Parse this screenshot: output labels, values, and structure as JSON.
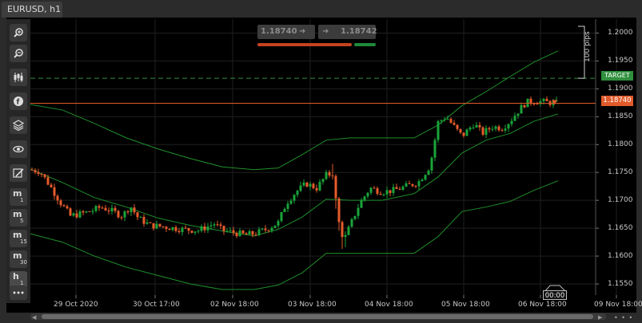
{
  "tab": {
    "title": "EURUSD, h1"
  },
  "toolbar": [
    {
      "name": "zoom-in-icon"
    },
    {
      "name": "zoom-out-icon"
    },
    {
      "name": "candlestick-icon"
    },
    {
      "name": "indicator-icon"
    },
    {
      "name": "layers-icon"
    },
    {
      "name": "eye-icon"
    },
    {
      "name": "draw-tool-icon"
    },
    {
      "name": "timeframe-m1",
      "main": "m",
      "sub": "1"
    },
    {
      "name": "timeframe-m5",
      "main": "m",
      "sub": "5"
    },
    {
      "name": "timeframe-m15",
      "main": "m",
      "sub": "15"
    },
    {
      "name": "timeframe-m30",
      "main": "m",
      "sub": "30"
    },
    {
      "name": "timeframe-h1",
      "main": "h",
      "sub": "1"
    },
    {
      "name": "more-icon"
    }
  ],
  "trade_panel": {
    "sell_price": "1.18740",
    "buy_price": "1.18742",
    "sell_color": "#c4431f",
    "buy_color": "#1f8a3a"
  },
  "axis": {
    "price_ticks": [
      "1.2000",
      "1.1950",
      "1.1900",
      "1.1850",
      "1.1800",
      "1.1750",
      "1.1700",
      "1.1650",
      "1.1600",
      "1.1550"
    ],
    "time_ticks": [
      "29 Oct 2020",
      "30 Oct 17:00",
      "02 Nov 18:00",
      "03 Nov 18:00",
      "04 Nov 18:00",
      "05 Nov 18:00",
      "06 Nov 18:00",
      "09 Nov 18:00"
    ]
  },
  "tags": {
    "target_label": "TARGET",
    "current_price": "1.18740",
    "pips_label": "100 pips",
    "time_countdown": "00:00"
  },
  "colors": {
    "bull": "#1aa33a",
    "bear": "#e65b2b",
    "band": "#1f8f2b",
    "price_line": "#e05a2b",
    "target_line": "#2f8f3d",
    "grid": "#1f1f1f"
  },
  "chart_data": {
    "type": "candlestick",
    "symbol": "EURUSD",
    "timeframe": "h1",
    "ylim": [
      1.153,
      1.2025
    ],
    "current_price": 1.1874,
    "target_price": 1.1919,
    "close_path": [
      [
        0,
        1.1755
      ],
      [
        12,
        1.1752
      ],
      [
        25,
        1.1725
      ],
      [
        38,
        1.1695
      ],
      [
        50,
        1.1672
      ],
      [
        60,
        1.1675
      ],
      [
        75,
        1.168
      ],
      [
        88,
        1.1688
      ],
      [
        100,
        1.1682
      ],
      [
        115,
        1.1672
      ],
      [
        125,
        1.169
      ],
      [
        135,
        1.1668
      ],
      [
        150,
        1.1655
      ],
      [
        170,
        1.1652
      ],
      [
        190,
        1.1648
      ],
      [
        210,
        1.1646
      ],
      [
        230,
        1.1658
      ],
      [
        240,
        1.1646
      ],
      [
        255,
        1.1642
      ],
      [
        268,
        1.1638
      ],
      [
        280,
        1.164
      ],
      [
        295,
        1.1648
      ],
      [
        310,
        1.166
      ],
      [
        320,
        1.1695
      ],
      [
        332,
        1.1715
      ],
      [
        345,
        1.173
      ],
      [
        358,
        1.1722
      ],
      [
        370,
        1.1745
      ],
      [
        378,
        1.1748
      ],
      [
        385,
        1.1665
      ],
      [
        392,
        1.1628
      ],
      [
        400,
        1.1655
      ],
      [
        412,
        1.1695
      ],
      [
        425,
        1.1722
      ],
      [
        440,
        1.1715
      ],
      [
        455,
        1.1718
      ],
      [
        470,
        1.1725
      ],
      [
        485,
        1.1732
      ],
      [
        500,
        1.1762
      ],
      [
        510,
        1.184
      ],
      [
        520,
        1.185
      ],
      [
        530,
        1.1832
      ],
      [
        540,
        1.1815
      ],
      [
        555,
        1.1838
      ],
      [
        565,
        1.182
      ],
      [
        578,
        1.1832
      ],
      [
        590,
        1.183
      ],
      [
        600,
        1.1842
      ],
      [
        610,
        1.186
      ],
      [
        620,
        1.1876
      ],
      [
        632,
        1.1878
      ],
      [
        645,
        1.1876
      ],
      [
        660,
        1.1874
      ]
    ],
    "bollinger": {
      "upper": [
        [
          0,
          1.1872
        ],
        [
          40,
          1.1862
        ],
        [
          80,
          1.1838
        ],
        [
          120,
          1.1812
        ],
        [
          160,
          1.1792
        ],
        [
          200,
          1.1775
        ],
        [
          240,
          1.176
        ],
        [
          280,
          1.1755
        ],
        [
          310,
          1.1758
        ],
        [
          340,
          1.1782
        ],
        [
          370,
          1.1808
        ],
        [
          400,
          1.1812
        ],
        [
          440,
          1.1812
        ],
        [
          480,
          1.1812
        ],
        [
          510,
          1.1835
        ],
        [
          540,
          1.187
        ],
        [
          570,
          1.1895
        ],
        [
          600,
          1.1922
        ],
        [
          630,
          1.1948
        ],
        [
          660,
          1.1968
        ]
      ],
      "middle": [
        [
          0,
          1.1756
        ],
        [
          40,
          1.1732
        ],
        [
          80,
          1.1705
        ],
        [
          120,
          1.1688
        ],
        [
          160,
          1.1668
        ],
        [
          200,
          1.1655
        ],
        [
          240,
          1.1645
        ],
        [
          280,
          1.1636
        ],
        [
          310,
          1.1648
        ],
        [
          340,
          1.167
        ],
        [
          370,
          1.1702
        ],
        [
          400,
          1.17
        ],
        [
          440,
          1.17
        ],
        [
          480,
          1.1712
        ],
        [
          510,
          1.1742
        ],
        [
          540,
          1.1785
        ],
        [
          570,
          1.1808
        ],
        [
          600,
          1.182
        ],
        [
          630,
          1.1842
        ],
        [
          660,
          1.1855
        ]
      ],
      "lower": [
        [
          0,
          1.164
        ],
        [
          40,
          1.1625
        ],
        [
          80,
          1.16
        ],
        [
          120,
          1.158
        ],
        [
          160,
          1.1565
        ],
        [
          200,
          1.155
        ],
        [
          240,
          1.154
        ],
        [
          280,
          1.154
        ],
        [
          310,
          1.1548
        ],
        [
          340,
          1.157
        ],
        [
          370,
          1.1605
        ],
        [
          400,
          1.1605
        ],
        [
          440,
          1.1605
        ],
        [
          480,
          1.1605
        ],
        [
          510,
          1.1635
        ],
        [
          540,
          1.168
        ],
        [
          570,
          1.1688
        ],
        [
          600,
          1.1698
        ],
        [
          630,
          1.1718
        ],
        [
          660,
          1.1735
        ]
      ]
    }
  }
}
